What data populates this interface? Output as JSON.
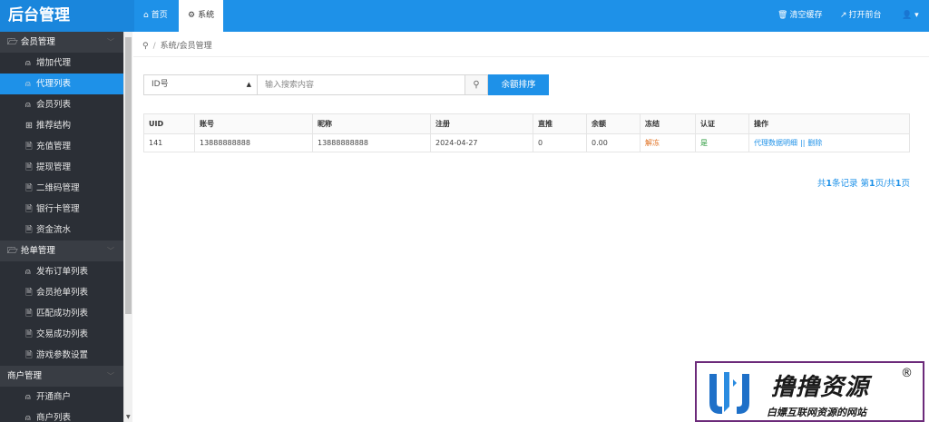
{
  "topbar": {
    "brand": "后台管理",
    "tabs": [
      {
        "label": "首页",
        "icon": "home-icon"
      },
      {
        "label": "系统",
        "icon": "gear-icon"
      }
    ],
    "right": {
      "clear_cache": "清空缓存",
      "open_frontend": "打开前台"
    },
    "accent_color": "#1e91e8"
  },
  "sidebar": {
    "groups": [
      {
        "title": "会员管理",
        "items": [
          {
            "label": "增加代理",
            "icon": "user-icon"
          },
          {
            "label": "代理列表",
            "icon": "user-icon",
            "active": true
          },
          {
            "label": "会员列表",
            "icon": "user-icon"
          },
          {
            "label": "推荐结构",
            "icon": "grid-icon"
          },
          {
            "label": "充值管理",
            "icon": "doc-icon"
          },
          {
            "label": "提现管理",
            "icon": "doc-icon"
          },
          {
            "label": "二维码管理",
            "icon": "doc-icon"
          },
          {
            "label": "银行卡管理",
            "icon": "doc-icon"
          },
          {
            "label": "资金流水",
            "icon": "doc-icon"
          }
        ]
      },
      {
        "title": "抢单管理",
        "items": [
          {
            "label": "发布订单列表",
            "icon": "user-icon"
          },
          {
            "label": "会员抢单列表",
            "icon": "doc-icon"
          },
          {
            "label": "匹配成功列表",
            "icon": "doc-icon"
          },
          {
            "label": "交易成功列表",
            "icon": "doc-icon"
          },
          {
            "label": "游戏参数设置",
            "icon": "doc-icon"
          }
        ]
      },
      {
        "title": "商户管理",
        "items": [
          {
            "label": "开通商户",
            "icon": "user-icon"
          },
          {
            "label": "商户列表",
            "icon": "user-icon"
          }
        ]
      }
    ]
  },
  "breadcrumb": {
    "path": "系统/会员管理"
  },
  "filter": {
    "select_value": "ID号",
    "search_placeholder": "输入搜索内容",
    "sort_button": "余额排序"
  },
  "table": {
    "headers": [
      "UID",
      "账号",
      "昵称",
      "注册",
      "直推",
      "余额",
      "冻结",
      "认证",
      "操作"
    ],
    "rows": [
      {
        "uid": "141",
        "account": "13888888888",
        "nickname": "13888888888",
        "registered": "2024-04-27",
        "direct": "0",
        "balance": "0.00",
        "freeze": "解冻",
        "certified": "是",
        "op_detail": "代理数据明细",
        "op_sep": "||",
        "op_delete": "删除"
      }
    ]
  },
  "pager": {
    "total_prefix": "共",
    "total_count": "1",
    "total_suffix": "条记录 第",
    "page": "1",
    "page_mid": "页/共",
    "pages": "1",
    "pages_suffix": "页"
  },
  "watermark": {
    "title": "撸撸资源",
    "registered_mark": "®",
    "subtitle": "白嫖互联网资源的网站"
  }
}
